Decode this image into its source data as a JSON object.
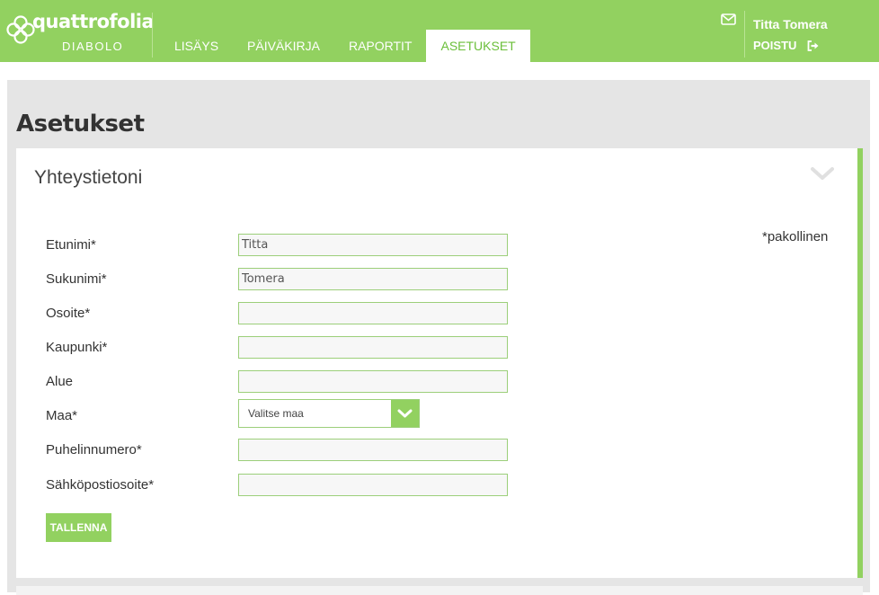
{
  "app": {
    "logo_text": "quattrofolia",
    "logo_sub": "DIABOLO"
  },
  "nav": {
    "tabs": [
      {
        "label": "LISÄYS"
      },
      {
        "label": "PÄIVÄKIRJA"
      },
      {
        "label": "RAPORTIT"
      },
      {
        "label": "ASETUKSET"
      }
    ]
  },
  "user": {
    "name": "Titta Tomera",
    "logout_label": "POISTU"
  },
  "page": {
    "title": "Asetukset"
  },
  "panel": {
    "title": "Yhteystietoni",
    "required_note": "*pakollinen"
  },
  "form": {
    "first_name": {
      "label": "Etunimi*",
      "value": "Titta"
    },
    "last_name": {
      "label": "Sukunimi*",
      "value": "Tomera"
    },
    "address": {
      "label": "Osoite*",
      "value": ""
    },
    "city": {
      "label": "Kaupunki*",
      "value": ""
    },
    "region": {
      "label": "Alue",
      "value": ""
    },
    "country": {
      "label": "Maa*",
      "selected": "Valitse maa"
    },
    "phone": {
      "label": "Puhelinnumero*",
      "value": ""
    },
    "email": {
      "label": "Sähköpostiosoite*",
      "value": ""
    },
    "save_label": "TALLENNA"
  },
  "colors": {
    "accent": "#92d160",
    "active_tab_text": "#6bbf3a",
    "background": "#e5e5e5"
  },
  "icons": {
    "mail": "envelope-icon",
    "logout": "sign-out-icon",
    "collapse": "chevron-down-icon",
    "select": "chevron-down-icon"
  }
}
